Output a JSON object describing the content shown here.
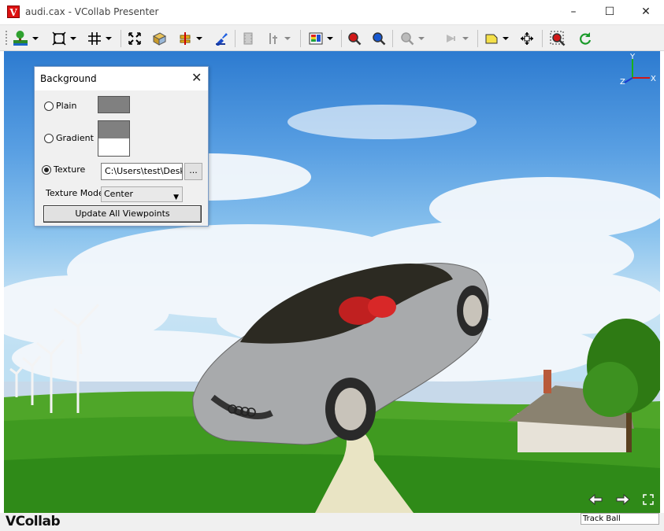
{
  "window": {
    "title": "audi.cax - VCollab Presenter",
    "app_icon": "vcollab-v-icon",
    "controls": {
      "minimize": "–",
      "maximize": "☐",
      "close": "✕"
    }
  },
  "toolbar": {
    "buttons": [
      "background-scene-icon",
      "fit-view-icon",
      "grid-icon",
      "explode-icon",
      "cube-view-icon",
      "section-plane-icon",
      "paint-icon",
      "animation-icon",
      "probe-icon",
      "legend-icon",
      "zoom-in-icon",
      "zoom-out-icon",
      "zoom-region-icon",
      "pointer-icon",
      "note-icon",
      "pan-icon",
      "zoom-box-icon",
      "refresh-icon"
    ]
  },
  "dialog": {
    "title": "Background",
    "close": "✕",
    "options": {
      "plain": "Plain",
      "gradient": "Gradient",
      "texture": "Texture"
    },
    "selected": "texture",
    "texture_path": "C:\\Users\\test\\Deskt",
    "browse_label": "...",
    "texture_mode_label": "Texture Mode",
    "texture_mode_value": "Center",
    "update_button": "Update All Viewpoints",
    "colors": {
      "plain": "#808080",
      "gradient_top": "#808080",
      "gradient_bottom": "#ffffff"
    }
  },
  "axes": {
    "x": "X",
    "y": "Y",
    "z": "Z"
  },
  "status": {
    "logo": "VCollab",
    "nav_prev": "prev-arrow-icon",
    "nav_next": "next-arrow-icon",
    "fullscreen": "fullscreen-icon",
    "mode": "Track Ball"
  }
}
